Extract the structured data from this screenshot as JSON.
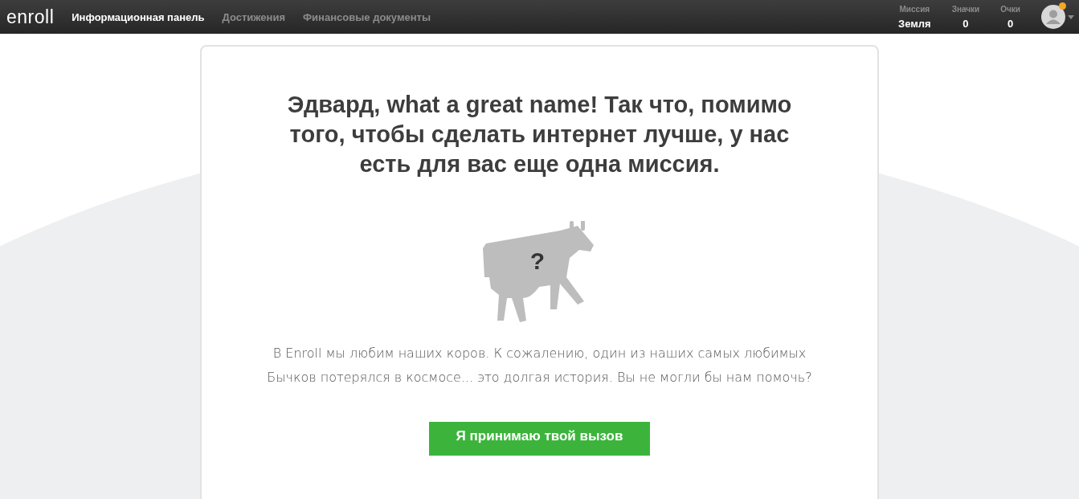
{
  "brand": "enroll",
  "nav": [
    {
      "label": "Информационная панель",
      "selected": true
    },
    {
      "label": "Достижения",
      "selected": false
    },
    {
      "label": "Финансовые документы",
      "selected": false
    }
  ],
  "stats": [
    {
      "label": "Миссия",
      "value": "Земля"
    },
    {
      "label": "Значки",
      "value": "0"
    },
    {
      "label": "Очки",
      "value": "0"
    }
  ],
  "user": {
    "notification": true
  },
  "card": {
    "heading": "Эдвард, what a great name! Так что, помимо того, чтобы сделать интернет лучше, у нас есть для вас еще одна миссия.",
    "mystery_mark": "?",
    "text": "В Enroll мы любим наших коров. К сожалению, один из наших самых любимых Бычков потерялся в космосе... это долгая история. Вы не могли бы нам помочь?",
    "button": "Я принимаю твой вызов"
  }
}
